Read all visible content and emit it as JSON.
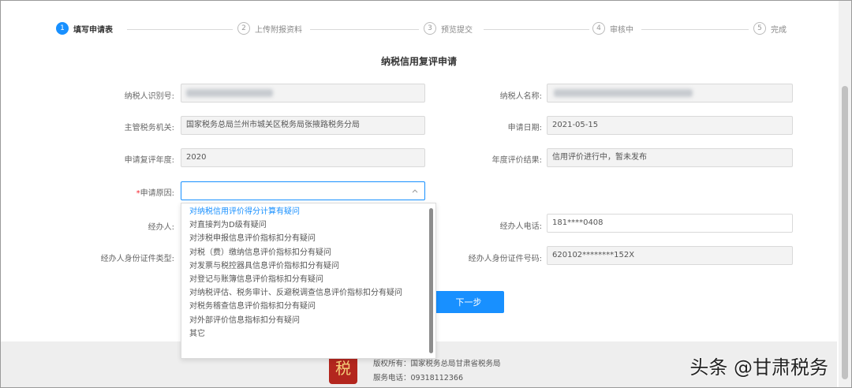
{
  "steps": [
    {
      "num": "1",
      "label": "填写申请表",
      "active": true
    },
    {
      "num": "2",
      "label": "上传附报资料"
    },
    {
      "num": "3",
      "label": "预览提交"
    },
    {
      "num": "4",
      "label": "审核中"
    },
    {
      "num": "5",
      "label": "完成"
    }
  ],
  "form": {
    "title": "纳税信用复评申请",
    "taxpayer_id_label": "纳税人识别号:",
    "taxpayer_name_label": "纳税人名称:",
    "tax_authority_label": "主管税务机关:",
    "tax_authority_value": "国家税务总局兰州市城关区税务局张掖路税务分局",
    "apply_date_label": "申请日期:",
    "apply_date_value": "2021-05-15",
    "review_year_label": "申请复评年度:",
    "review_year_value": "2020",
    "annual_result_label": "年度评价结果:",
    "annual_result_value": "信用评价进行中，暂未发布",
    "reason_required_mark": "*",
    "reason_label": "申请原因:",
    "handler_label": "经办人:",
    "handler_phone_label": "经办人电话:",
    "handler_phone_value": "181****0408",
    "handler_id_type_label": "经办人身份证件类型:",
    "handler_id_no_label": "经办人身份证件号码:",
    "handler_id_no_value": "620102********152X",
    "next_button": "下一步"
  },
  "reason_options": [
    "对纳税信用评价得分计算有疑问",
    "对直接判为D级有疑问",
    "对涉税申报信息评价指标扣分有疑问",
    "对税（费）缴纳信息评价指标扣分有疑问",
    "对发票与税控器具信息评价指标扣分有疑问",
    "对登记与账簿信息评价指标扣分有疑问",
    "对纳税评估、税务审计、反避税调查信息评价指标扣分有疑问",
    "对税务稽查信息评价指标扣分有疑问",
    "对外部评价信息指标扣分有疑问",
    "其它"
  ],
  "footer": {
    "copyright": "版权所有：国家税务总局甘肃省税务局",
    "service_phone": "服务电话：09318112366",
    "logo_glyph": "税"
  },
  "watermark": "头条 @甘肃税务",
  "colors": {
    "accent": "#1890ff",
    "required": "#f5222d"
  }
}
